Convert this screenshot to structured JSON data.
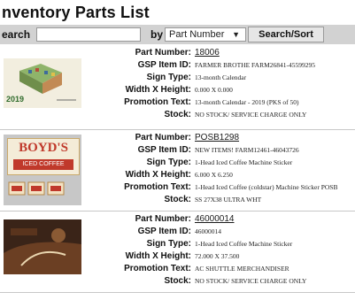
{
  "page": {
    "title": "nventory Parts List"
  },
  "search": {
    "label": "earch",
    "value": "",
    "by_label": "by",
    "sort_by_selected": "Part Number",
    "button_label": "Search/Sort"
  },
  "field_labels": {
    "part_number": "Part Number:",
    "gsp_item_id": "GSP Item ID:",
    "sign_type": "Sign Type:",
    "width_height": "Width X Height:",
    "promotion_text": "Promotion Text:",
    "stock": "Stock:"
  },
  "items": [
    {
      "part_number": "18006",
      "gsp_item_id": "FARMER BROTHE FARM26841-45599295",
      "sign_type": "13-month Calendar",
      "width_height": "0.000 X 0.000",
      "promotion_text": "13-month Calendar - 2019 (PKS of 50)",
      "stock": "NO STOCK/ SERVICE CHARGE ONLY",
      "thumb_year": "2019"
    },
    {
      "part_number": "POSB1298",
      "gsp_item_id": "NEW ITEMS! FARM12461-46043726",
      "sign_type": "1-Head Iced Coffee Machine Sticker",
      "width_height": "6.000 X 6.250",
      "promotion_text": "1-Head Iced Coffee (coldstar) Machine Sticker POSB",
      "stock": "SS 27X38 ULTRA WHT",
      "thumb_brand": "BOYD'S",
      "thumb_sub": "ICED COFFEE"
    },
    {
      "part_number": "46000014",
      "gsp_item_id": "46000014",
      "sign_type": "1-Head Iced Coffee Machine Sticker",
      "width_height": "72.000 X 37.500",
      "promotion_text": "AC SHUTTLE MERCHANDISER",
      "stock": "NO STOCK/ SERVICE CHARGE ONLY"
    }
  ]
}
